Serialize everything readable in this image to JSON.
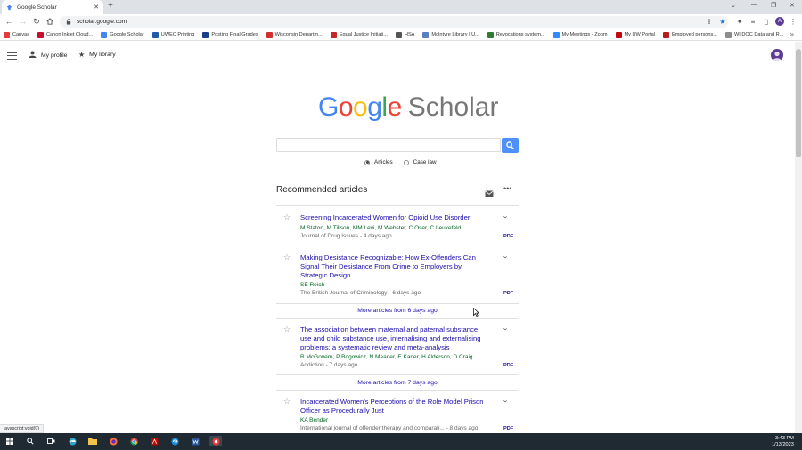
{
  "browser": {
    "tab_title": "Google Scholar",
    "url": "scholar.google.com",
    "profile_initial": "A",
    "bookmarks": [
      {
        "label": "Canvas",
        "color": "#e23c3c"
      },
      {
        "label": "Canon Inkjet Cloud...",
        "color": "#c8102e"
      },
      {
        "label": "Google Scholar",
        "color": "#4285f4"
      },
      {
        "label": "UWEC Printing",
        "color": "#1f5ba8"
      },
      {
        "label": "Posting Final Grades",
        "color": "#1a3f8a"
      },
      {
        "label": "Wisconsin Departm...",
        "color": "#d32f2f"
      },
      {
        "label": "Equal Justice Initiati...",
        "color": "#c62828"
      },
      {
        "label": "HSA",
        "color": "#555555"
      },
      {
        "label": "McIntyre Library | U...",
        "color": "#5b7fbf"
      },
      {
        "label": "Revocations system...",
        "color": "#2e7d32"
      },
      {
        "label": "My Meetings - Zoom",
        "color": "#2d8cff"
      },
      {
        "label": "My UW Portal",
        "color": "#c5050c"
      },
      {
        "label": "Employed persons...",
        "color": "#b71c1c"
      },
      {
        "label": "WI DOC Data and R...",
        "color": "#8d8d8d"
      }
    ]
  },
  "nav": {
    "profile_label": "My profile",
    "library_label": "My library"
  },
  "logo": {
    "google": "Google",
    "scholar": "Scholar",
    "colors": [
      "#4285f4",
      "#ea4335",
      "#fbbc05",
      "#4285f4",
      "#34a853",
      "#ea4335"
    ]
  },
  "search": {
    "placeholder": "",
    "option_articles": "Articles",
    "option_caselaw": "Case law"
  },
  "recommended": {
    "heading": "Recommended articles",
    "articles": [
      {
        "title": "Screening Incarcerated Women for Opioid Use Disorder",
        "authors": "M Staton, M Tillson, MM Levi, M Webster, C Oser, C Leukefeld",
        "journal": "Journal of Drug Issues - 4 days ago",
        "pdf": "PDF"
      },
      {
        "title": "Making Desistance Recognizable: How Ex-Offenders Can Signal Their Desistance From Crime to Employers by Strategic Design",
        "authors": "SE Reich",
        "journal": "The British Journal of Criminology - 6 days ago",
        "pdf": "PDF"
      },
      {
        "title": "The association between maternal and paternal substance use and child substance use, internalising and externalising problems: a systematic review and meta-analysis",
        "authors": "R McGovern, P Bogowicz, N Meader, E Kaner, H Alderson, D Craig...",
        "journal": "Addiction - 7 days ago",
        "pdf": "PDF"
      },
      {
        "title": "Incarcerated Women's Perceptions of the Role Model Prison Officer as Procedurally Just",
        "authors": "KA Bender",
        "journal": "International journal of offender therapy and comparati... - 8 days ago",
        "pdf": "PDF"
      }
    ],
    "more_6": "More articles from 6 days ago",
    "more_7": "More articles from 7 days ago"
  },
  "status_url": "javascript:void(0)",
  "taskbar": {
    "time": "3:43 PM",
    "date": "1/13/2023"
  }
}
